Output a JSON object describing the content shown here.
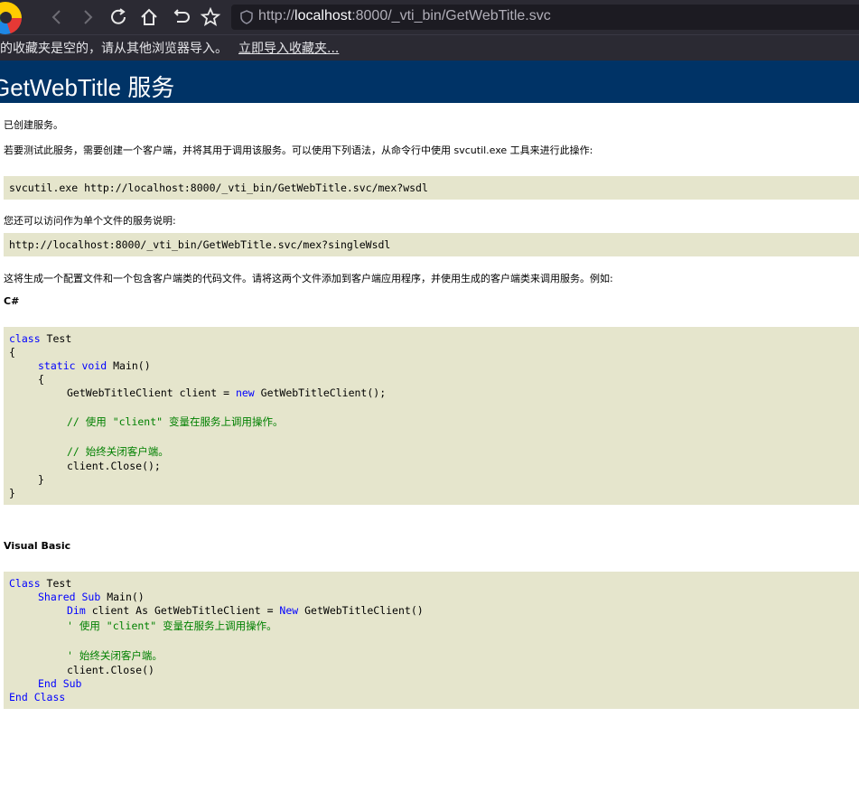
{
  "browser": {
    "url_host": "localhost",
    "url_scheme": "http://",
    "url_rest": ":8000/_vti_bin/GetWebTitle.svc",
    "bookmark_message": "的收藏夹是空的，请从其他浏览器导入。",
    "bookmark_import_link": "立即导入收藏夹..."
  },
  "page": {
    "title": "GetWebTitle 服务",
    "created": "已创建服务。",
    "test_intro": "若要测试此服务，需要创建一个客户端，并将其用于调用该服务。可以使用下列语法，从命令行中使用 svcutil.exe 工具来进行此操作:",
    "svcutil_cmd": "svcutil.exe ",
    "mex_wsdl_url": "http://localhost:8000/_vti_bin/GetWebTitle.svc/mex?wsdl",
    "single_file_intro": "您还可以访问作为单个文件的服务说明:",
    "single_wsdl_url": "http://localhost:8000/_vti_bin/GetWebTitle.svc/mex?singleWsdl",
    "generate_intro": "这将生成一个配置文件和一个包含客户端类的代码文件。请将这两个文件添加到客户端应用程序，并使用生成的客户端类来调用服务。例如:",
    "csharp_label": "C#",
    "vb_label": "Visual Basic"
  },
  "csharp": {
    "l1_kw": "class",
    "l1_rest": " Test",
    "l2": "{",
    "l3_kw1": "static",
    "l3_kw2": "void",
    "l3_rest": " Main()",
    "l4": "{",
    "l5_a": "GetWebTitleClient client = ",
    "l5_kw": "new",
    "l5_b": " GetWebTitleClient();",
    "l6": "// 使用 \"client\" 变量在服务上调用操作。",
    "l7": "// 始终关闭客户端。",
    "l8": "client.Close();",
    "l9": "}",
    "l10": "}"
  },
  "vb": {
    "l1_kw": "Class",
    "l1_rest": " Test",
    "l2_kw1": "Shared",
    "l2_kw2": "Sub",
    "l2_rest": " Main()",
    "l3_kw1": "Dim",
    "l3_mid": " client As GetWebTitleClient = ",
    "l3_kw2": "New",
    "l3_rest": " GetWebTitleClient()",
    "l4": "' 使用 \"client\" 变量在服务上调用操作。",
    "l5": "' 始终关闭客户端。",
    "l6": "client.Close()",
    "l7": "End Sub",
    "l8": "End Class"
  },
  "icons": [
    "browser-logo-icon",
    "back-icon",
    "forward-icon",
    "reload-icon",
    "home-icon",
    "undo-icon",
    "star-icon",
    "shield-icon"
  ]
}
